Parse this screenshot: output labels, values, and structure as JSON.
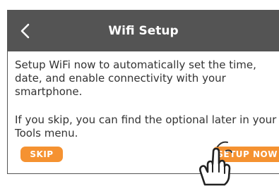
{
  "header": {
    "back_icon": "chevron-left-icon",
    "title": "Wifi Setup",
    "background": "#545454"
  },
  "content": {
    "paragraph_1": "Setup WiFi now to automatically set the time, date, and enable connectivity with your smartphone.",
    "paragraph_2": "If you skip, you can find the optional later in your Tools menu."
  },
  "actions": {
    "skip_label": "SKIP",
    "setup_now_label": "SETUP NOW",
    "button_color": "#f59231"
  },
  "overlay": {
    "pointer_icon": "tapping-hand-icon"
  }
}
